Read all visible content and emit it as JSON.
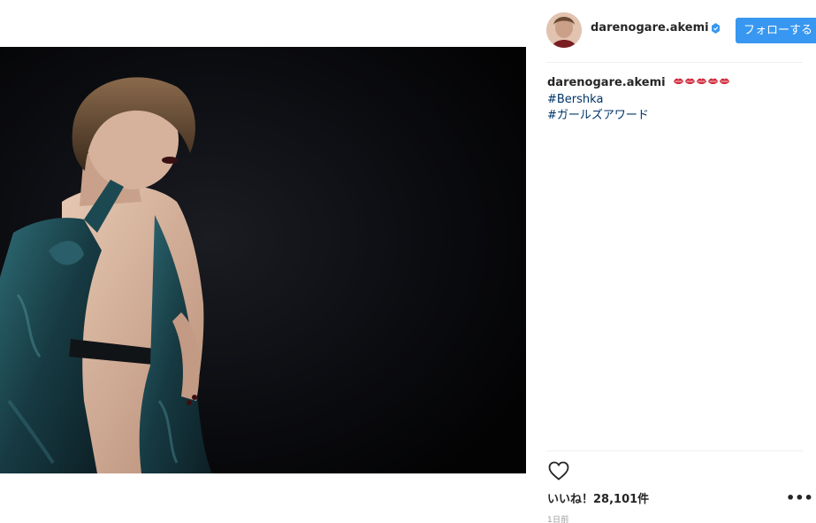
{
  "post": {
    "username": "darenogare.akemi",
    "follow_label": "フォローする",
    "caption": {
      "author": "darenogare.akemi",
      "emoji": "💋💋💋💋💋",
      "hashtags": [
        "#Bershka",
        "#ガールズアワード"
      ]
    },
    "likes_label": "いいね！28,101件",
    "timestamp": "1日前",
    "colors": {
      "accent": "#3897f0",
      "hashtag": "#003569",
      "photo_background": "#050608",
      "dress": "#1f4a52"
    },
    "icons": {
      "verified": "verified-badge-icon",
      "heart": "heart-outline-icon",
      "more": "more-options-icon"
    }
  }
}
